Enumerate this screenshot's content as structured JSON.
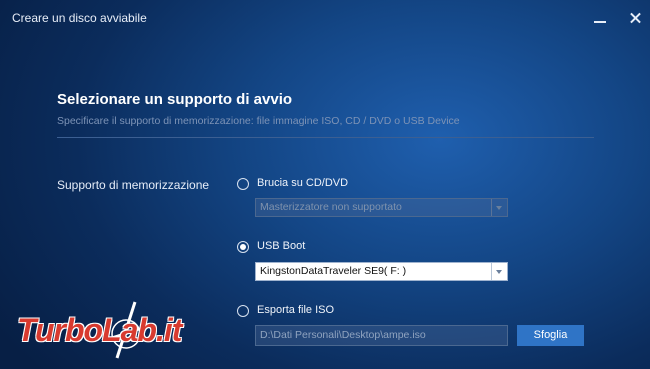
{
  "window": {
    "title": "Creare un disco avviabile"
  },
  "header": {
    "heading": "Selezionare un supporto di avvio",
    "subheading": "Specificare il supporto di memorizzazione: file immagine ISO, CD / DVD o USB Device"
  },
  "storage": {
    "section_label": "Supporto di memorizzazione",
    "options": [
      {
        "label": "Brucia su CD/DVD",
        "checked": false,
        "select_value": "Masterizzatore non supportato",
        "enabled": false
      },
      {
        "label": "USB Boot",
        "checked": true,
        "select_value": "KingstonDataTraveler SE9( F: )",
        "enabled": true
      },
      {
        "label": "Esporta file ISO",
        "checked": false,
        "path_value": "D:\\Dati Personali\\Desktop\\ampe.iso",
        "enabled": false
      }
    ],
    "browse_label": "Sfoglia"
  },
  "watermark": {
    "text": "TurboLab.it"
  },
  "colors": {
    "background": "#134584",
    "accent_button": "#2f74c6",
    "watermark": "#d83a2f"
  },
  "icons": [
    "minimize-icon",
    "close-icon",
    "chevron-down-icon",
    "logo-glyph"
  ]
}
